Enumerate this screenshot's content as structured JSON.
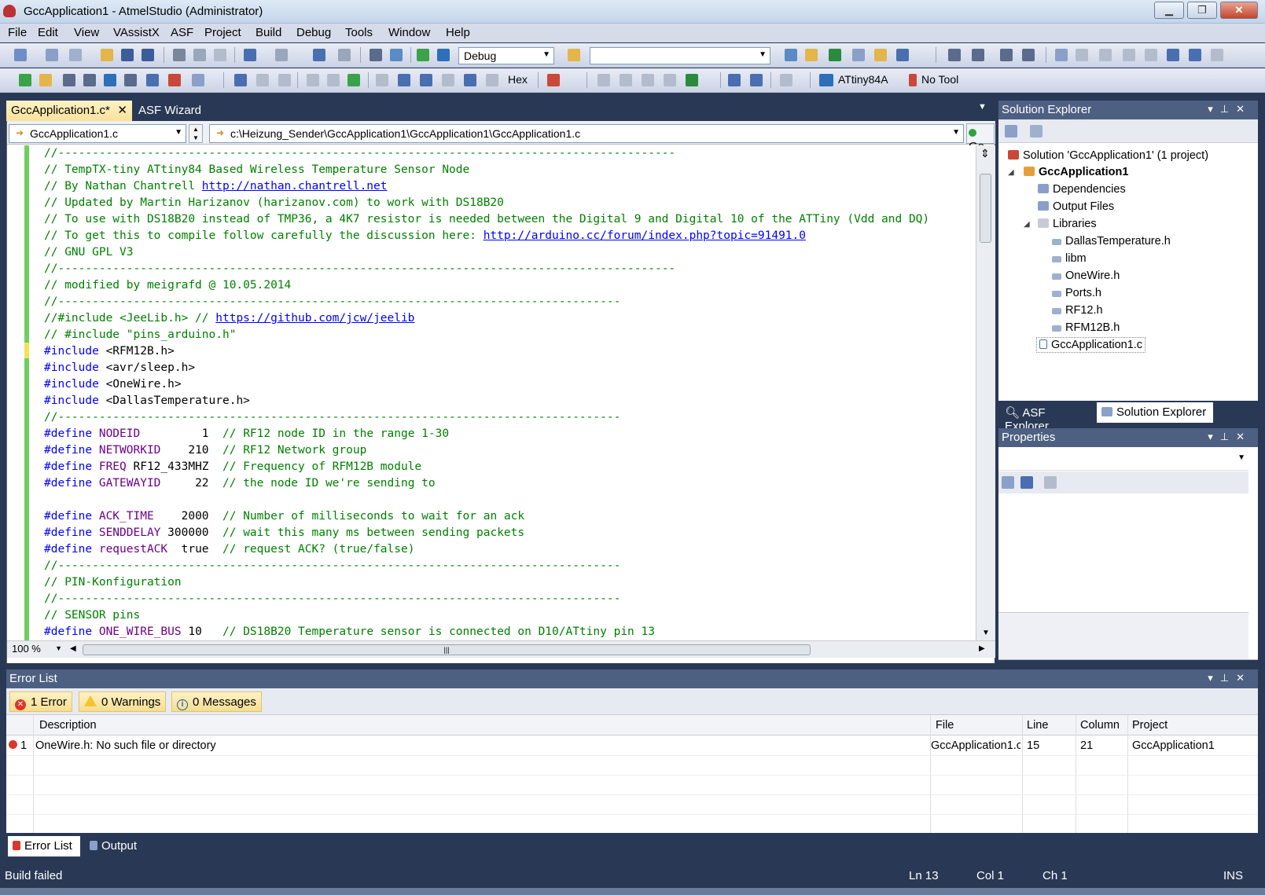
{
  "window": {
    "title": "GccApplication1 - AtmelStudio (Administrator)"
  },
  "menu": [
    "File",
    "Edit",
    "View",
    "VAssistX",
    "ASF",
    "Project",
    "Build",
    "Debug",
    "Tools",
    "Window",
    "Help"
  ],
  "toolbar": {
    "config_value": "Debug",
    "search_value": "",
    "hex_label": "Hex",
    "device_label": "ATtiny84A",
    "tool_label": "No Tool"
  },
  "editor_tabs": {
    "active_label": "GccApplication1.c*",
    "active_close": "✕",
    "other_label": "ASF Wizard"
  },
  "navbar": {
    "file_combo": "GccApplication1.c",
    "path_combo": "c:\\Heizung_Sender\\GccApplication1\\GccApplication1\\GccApplication1.c",
    "go_label": "Go"
  },
  "code_lines": [
    "//------------------------------------------------------------------------------------------",
    "// TempTX-tiny ATtiny84 Based Wireless Temperature Sensor Node",
    "// By Nathan Chantrell http://nathan.chantrell.net",
    "// Updated by Martin Harizanov (harizanov.com) to work with DS18B20",
    "// To use with DS18B20 instead of TMP36, a 4K7 resistor is needed between the Digital 9 and Digital 10 of the ATTiny (Vdd and DQ)",
    "// To get this to compile follow carefully the discussion here: http://arduino.cc/forum/index.php?topic=91491.0",
    "// GNU GPL V3",
    "//------------------------------------------------------------------------------------------",
    "// modified by meigrafd @ 10.05.2014",
    "//----------------------------------------------------------------------------------",
    "//#include <JeeLib.h> // https://github.com/jcw/jeelib",
    "// #include \"pins_arduino.h\"",
    "#include <RFM12B.h>",
    "#include <avr/sleep.h>",
    "#include <OneWire.h>",
    "#include <DallasTemperature.h>",
    "//----------------------------------------------------------------------------------",
    "#define NODEID         1  // RF12 node ID in the range 1-30",
    "#define NETWORKID    210  // RF12 Network group",
    "#define FREQ RF12_433MHZ  // Frequency of RFM12B module",
    "#define GATEWAYID     22  // the node ID we're sending to",
    "",
    "#define ACK_TIME    2000  // Number of milliseconds to wait for an ack",
    "#define SENDDELAY 300000  // wait this many ms between sending packets",
    "#define requestACK  true  // request ACK? (true/false)",
    "//----------------------------------------------------------------------------------",
    "// PIN-Konfiguration",
    "//----------------------------------------------------------------------------------",
    "// SENSOR pins",
    "#define ONE_WIRE_BUS 10   // DS18B20 Temperature sensor is connected on D10/ATtiny pin 13"
  ],
  "editor_status": {
    "zoom": "100 %"
  },
  "solution_explorer": {
    "title": "Solution Explorer",
    "solution": "Solution 'GccApplication1' (1 project)",
    "project": "GccApplication1",
    "items": [
      "Dependencies",
      "Output Files",
      "Libraries"
    ],
    "library_items": [
      "DallasTemperature.h",
      "libm",
      "OneWire.h",
      "Ports.h",
      "RF12.h",
      "RFM12B.h"
    ],
    "selected_file": "GccApplication1.c",
    "tab_asf": "ASF Explorer",
    "tab_solution": "Solution Explorer"
  },
  "properties": {
    "title": "Properties"
  },
  "error_list": {
    "title": "Error List",
    "errors_btn": "1 Error",
    "warnings_btn": "0 Warnings",
    "messages_btn": "0 Messages",
    "columns": {
      "description": "Description",
      "file": "File",
      "line": "Line",
      "column": "Column",
      "project": "Project"
    },
    "rows": [
      {
        "num": "1",
        "description": "OneWire.h: No such file or directory",
        "file": "GccApplication1.c",
        "line": "15",
        "column": "21",
        "project": "GccApplication1"
      }
    ]
  },
  "bottom_tabs": {
    "error_list": "Error List",
    "output": "Output"
  },
  "status": {
    "message": "Build failed",
    "ln": "Ln 13",
    "col": "Col 1",
    "ch": "Ch 1",
    "mode": "INS"
  },
  "colors": {
    "comment": "#008000",
    "keyword": "#0000ff",
    "macro": "#6f008a",
    "chrome": "#293955"
  }
}
